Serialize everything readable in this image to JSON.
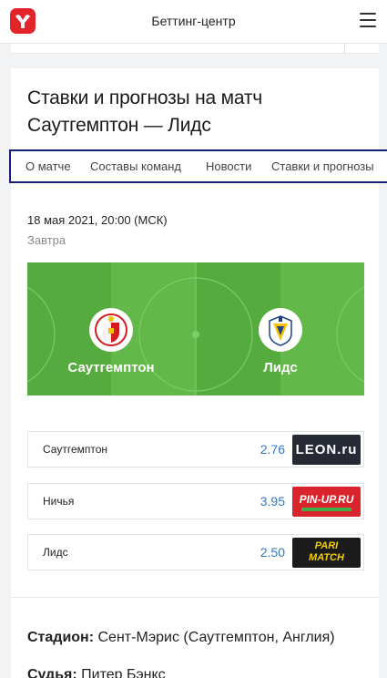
{
  "header": {
    "title": "Беттинг-центр"
  },
  "page": {
    "title": "Ставки и прогнозы на матч Саутгемптон — Лидс"
  },
  "tabs": [
    {
      "label": "О матче"
    },
    {
      "label": "Составы команд"
    },
    {
      "label": "Новости"
    },
    {
      "label": "Ставки и прогнозы"
    }
  ],
  "match": {
    "date": "18 мая 2021, 20:00 (МСК)",
    "relative": "Завтра",
    "home": "Саутгемптон",
    "away": "Лидс"
  },
  "odds": [
    {
      "label": "Саутгемптон",
      "value": "2.76",
      "bookmaker": "LEON.ru"
    },
    {
      "label": "Ничья",
      "value": "3.95",
      "bookmaker": "PIN-UP.RU"
    },
    {
      "label": "Лидс",
      "value": "2.50",
      "bookmaker": "PARI MATCH"
    }
  ],
  "info": {
    "stadium_label": "Стадион:",
    "stadium_value": "Сент-Мэрис (Саутгемптон, Англия)",
    "referee_label": "Судья:",
    "referee_value": "Питер Бэнкс"
  },
  "colors": {
    "accent": "#e3242b",
    "field": "#5cb343",
    "odds": "#2d7ac8",
    "tabs_border": "#16217a"
  }
}
